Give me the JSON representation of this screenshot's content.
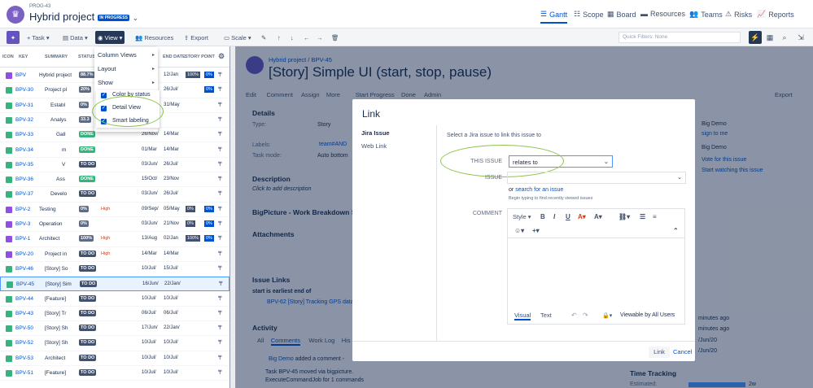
{
  "header": {
    "project_key": "PROG-43",
    "project_title": "Hybrid project",
    "status_badge": "IN PROGRESS",
    "nav": [
      "Gantt",
      "Scope",
      "Board",
      "Resources",
      "Teams",
      "Risks",
      "Reports"
    ],
    "active_nav": "Gantt"
  },
  "toolbar": {
    "task": "Task",
    "data": "Data",
    "view": "View",
    "resources": "Resources",
    "export": "Export",
    "scale": "Scale",
    "quick_filters": "Quick Filters: None"
  },
  "grid": {
    "columns": [
      "ICON",
      "KEY",
      "SUMMARY",
      "STATUS",
      "END DATE",
      "STORY POINT"
    ],
    "rows": [
      {
        "key": "BPV",
        "summary": "Hybrid project",
        "status": "88.7%",
        "d2": "12/Jan",
        "sp": "100%",
        "sp2": "0%",
        "type": "epic",
        "indent": 0
      },
      {
        "key": "BPV-30",
        "summary": "Project pl",
        "status": "20%",
        "d2": "26/Jul/",
        "sp": "",
        "sp2": "0%",
        "type": "story",
        "indent": 1
      },
      {
        "key": "BPV-31",
        "summary": "Establ",
        "status": "0%",
        "d2": "31/May",
        "sp": "",
        "sp2": "",
        "type": "story",
        "indent": 2
      },
      {
        "key": "BPV-32",
        "summary": "Analys",
        "status": "33.3",
        "d2": "",
        "sp": "",
        "sp2": "",
        "type": "story",
        "indent": 2
      },
      {
        "key": "BPV-33",
        "summary": "Gall",
        "status": "DONE",
        "d1": "26/Nov/",
        "d2": "14/Mar",
        "sp": "",
        "sp2": "",
        "type": "story",
        "indent": 3
      },
      {
        "key": "BPV-34",
        "summary": "m",
        "status": "DONE",
        "d1": "01/Mar",
        "d2": "14/Mar",
        "sp": "",
        "sp2": "",
        "type": "story",
        "indent": 4
      },
      {
        "key": "BPV-35",
        "summary": "V",
        "status": "TO DO",
        "d1": "03/Jun/",
        "d2": "26/Jul/",
        "sp": "",
        "sp2": "",
        "type": "story",
        "indent": 4
      },
      {
        "key": "BPV-36",
        "summary": "Ass",
        "status": "DONE",
        "d1": "15/Oct/",
        "d2": "23/Nov",
        "sp": "",
        "sp2": "",
        "type": "story",
        "indent": 3
      },
      {
        "key": "BPV-37",
        "summary": "Develo",
        "status": "TO DO",
        "d1": "03/Jun/",
        "d2": "26/Jul/",
        "sp": "",
        "sp2": "",
        "type": "story",
        "indent": 2
      },
      {
        "key": "BPV-2",
        "summary": "Testing",
        "status": "0%",
        "prio": "High",
        "d1": "09/Sep/",
        "d2": "05/May",
        "sp": "0%",
        "sp2": "0%",
        "type": "epic",
        "indent": 0
      },
      {
        "key": "BPV-3",
        "summary": "Operation",
        "status": "0%",
        "d1": "03/Jun/",
        "d2": "21/Nov",
        "sp": "0%",
        "sp2": "0%",
        "type": "epic",
        "indent": 0
      },
      {
        "key": "BPV-1",
        "summary": "Architect",
        "status": "100%",
        "prio": "High",
        "d1": "13/Aug",
        "d2": "02/Jan",
        "sp": "100%",
        "sp2": "0%",
        "type": "epic",
        "indent": 0
      },
      {
        "key": "BPV-20",
        "summary": "Project in",
        "status": "TO DO",
        "prio": "High",
        "d1": "14/Mar",
        "d2": "14/Mar",
        "sp": "",
        "sp2": "",
        "type": "epic",
        "indent": 1
      },
      {
        "key": "BPV-46",
        "summary": "[Story] So",
        "status": "TO DO",
        "d1": "10/Jul/",
        "d2": "15/Jul/",
        "sp": "",
        "sp2": "",
        "type": "story",
        "indent": 1
      },
      {
        "key": "BPV-45",
        "summary": "[Story] Sim",
        "status": "TO DO",
        "d1": "16/Jun/",
        "d2": "22/Jan/",
        "sp": "",
        "sp2": "",
        "type": "story",
        "indent": 1
      },
      {
        "key": "BPV-44",
        "summary": "[Feature]",
        "status": "TO DO",
        "d1": "10/Jul/",
        "d2": "10/Jul/",
        "sp": "",
        "sp2": "",
        "type": "story",
        "indent": 1
      },
      {
        "key": "BPV-43",
        "summary": "[Story] Tr",
        "status": "TO DO",
        "d1": "06/Jul/",
        "d2": "06/Jul/",
        "sp": "",
        "sp2": "",
        "type": "story",
        "indent": 1
      },
      {
        "key": "BPV-50",
        "summary": "[Story] Sh",
        "status": "TO DO",
        "d1": "17/Jun/",
        "d2": "22/Jan/",
        "sp": "",
        "sp2": "",
        "type": "story",
        "indent": 1
      },
      {
        "key": "BPV-52",
        "summary": "[Story] Sh",
        "status": "TO DO",
        "d1": "10/Jul/",
        "d2": "10/Jul/",
        "sp": "",
        "sp2": "",
        "type": "story",
        "indent": 1
      },
      {
        "key": "BPV-53",
        "summary": "Architect",
        "status": "TO DO",
        "d1": "10/Jul/",
        "d2": "10/Jul/",
        "sp": "",
        "sp2": "",
        "type": "story",
        "indent": 1
      },
      {
        "key": "BPV-51",
        "summary": "[Feature]",
        "status": "TO DO",
        "d1": "10/Jul/",
        "d2": "10/Jul/",
        "sp": "",
        "sp2": "",
        "type": "story",
        "indent": 1
      }
    ]
  },
  "view_menu": {
    "items": [
      "Column Views",
      "Layout",
      "Show"
    ],
    "submenu": [
      "Color by status",
      "Detail View",
      "Smart labeling"
    ]
  },
  "issue": {
    "breadcrumb_project": "Hybrid project",
    "breadcrumb_key": "BPV-45",
    "title": "[Story] Simple UI (start, stop, pause)",
    "actions": [
      "Edit",
      "Comment",
      "Assign",
      "More",
      "Start Progress",
      "Done",
      "Admin"
    ],
    "export": "Export",
    "details_heading": "Details",
    "type_label": "Type:",
    "type_value": "Story",
    "labels_label": "Labels:",
    "labels_value": "team#AND",
    "taskmode_label": "Task mode:",
    "taskmode_value": "Auto bottom",
    "description_heading": "Description",
    "description_placeholder": "Click to add description",
    "bigpicture_heading": "BigPicture - Work Breakdown Str",
    "attachments_heading": "Attachments",
    "links_heading": "Issue Links",
    "links_sub": "start is earliest end of",
    "link_item": "BPV-62 [Story] Tracking GPS data",
    "activity_heading": "Activity",
    "activity_tabs": [
      "All",
      "Comments",
      "Work Log",
      "His"
    ],
    "comment_author": "Big Demo",
    "comment_text": "added a comment -",
    "comment_body_1": "Task BPV-45 moved via bigpicture.",
    "comment_body_2": "ExecuteCommandJob for 1 commands",
    "people": [
      "Big Demo",
      "sign to me",
      "Big Demo",
      "Vote for this issue",
      "Start watching this issue"
    ],
    "time_tracking": "Time Tracking",
    "estimated": "Estimated:",
    "estimated_val": "2w",
    "dates": [
      "minutes ago",
      "minutes ago",
      "/Jun/20",
      "/Jun/20"
    ]
  },
  "dialog": {
    "title": "Link",
    "tabs": [
      "Jira Issue",
      "Web Link"
    ],
    "intro": "Select a Jira issue to link this issue to",
    "this_issue_label": "THIS ISSUE",
    "relation_value": "relates to",
    "issue_label": "ISSUE",
    "or_text": "or",
    "search_link": "search for an issue",
    "hint": "Begin typing to find recently viewed issues",
    "comment_label": "COMMENT",
    "editor_style": "Style",
    "editor_tabs": [
      "Visual",
      "Text"
    ],
    "viewable": "Viewable by All Users",
    "link_button": "Link",
    "cancel": "Cancel"
  }
}
